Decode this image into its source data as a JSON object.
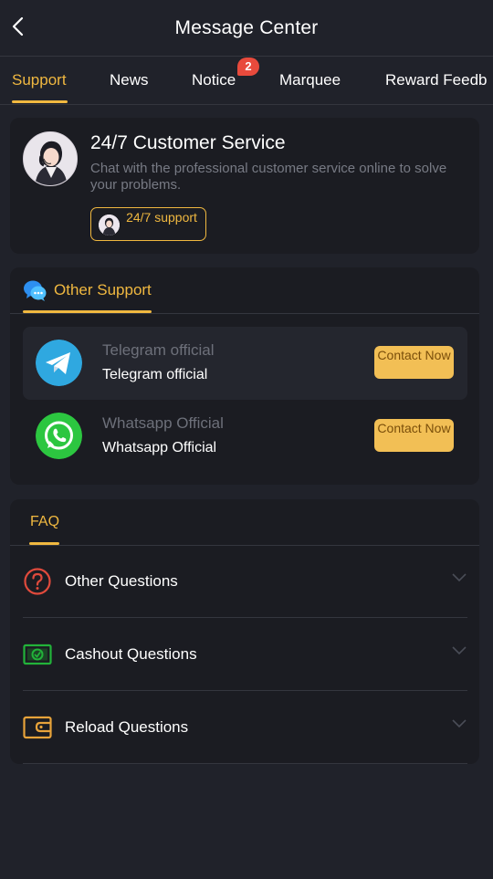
{
  "header": {
    "title": "Message Center"
  },
  "tabs": [
    {
      "label": "Support",
      "active": true
    },
    {
      "label": "News"
    },
    {
      "label": "Notice",
      "badge": "2"
    },
    {
      "label": "Marquee"
    },
    {
      "label": "Reward Feedb"
    }
  ],
  "customer_service": {
    "title": "24/7 Customer Service",
    "description": "Chat with the professional customer service online to solve your problems.",
    "button_label": "24/7 support"
  },
  "other_support": {
    "title": "Other Support",
    "items": [
      {
        "name": "Telegram official",
        "subname": "Telegram official",
        "button": "Contact Now",
        "icon": "telegram-icon"
      },
      {
        "name": "Whatsapp Official",
        "subname": "Whatsapp Official",
        "button": "Contact Now",
        "icon": "whatsapp-icon"
      }
    ]
  },
  "faq": {
    "title": "FAQ",
    "items": [
      {
        "label": "Other Questions",
        "icon": "question-circle-icon"
      },
      {
        "label": "Cashout Questions",
        "icon": "cash-icon"
      },
      {
        "label": "Reload Questions",
        "icon": "wallet-icon"
      }
    ]
  },
  "colors": {
    "background": "#20222a",
    "card": "#1b1c22",
    "accent": "#f0b840",
    "badge": "#e84a3c",
    "contact_button": "#f2bf55"
  }
}
